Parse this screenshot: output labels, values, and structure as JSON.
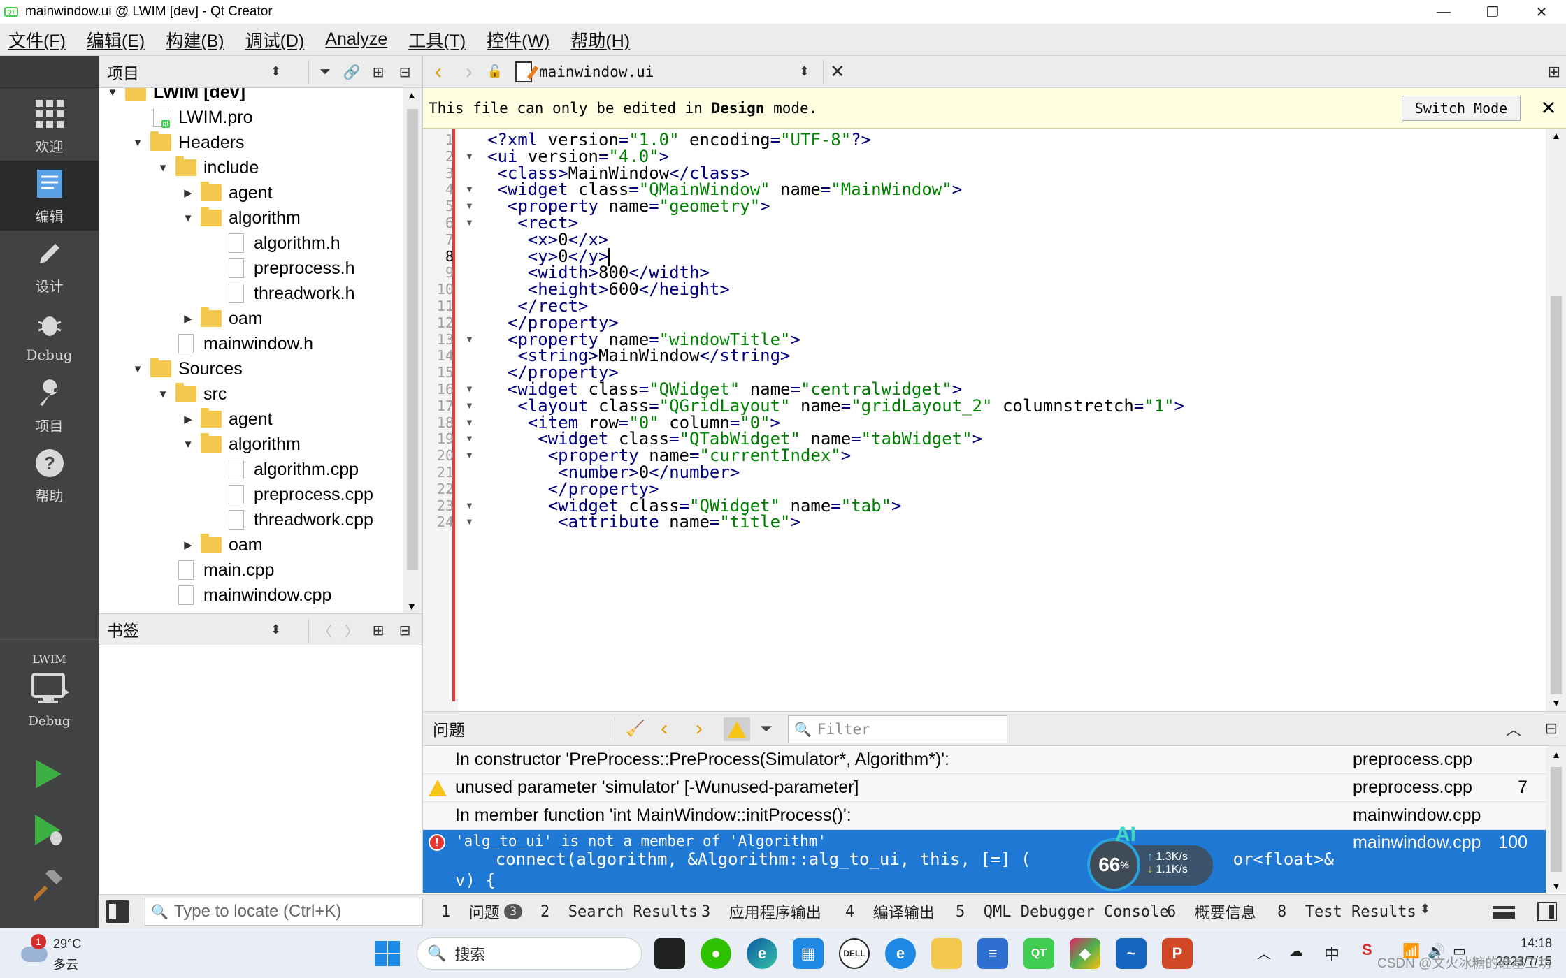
{
  "window": {
    "title": "mainwindow.ui @ LWIM [dev] - Qt Creator",
    "app_icon": "QT"
  },
  "menubar": {
    "items": [
      "文件(F)",
      "编辑(E)",
      "构建(B)",
      "调试(D)",
      "Analyze",
      "工具(T)",
      "控件(W)",
      "帮助(H)"
    ]
  },
  "modes": [
    {
      "label": "欢迎",
      "icon": "welcome-grid-icon"
    },
    {
      "label": "编辑",
      "icon": "edit-document-icon",
      "active": true
    },
    {
      "label": "设计",
      "icon": "design-pencil-icon"
    },
    {
      "label": "Debug",
      "icon": "debug-bug-icon"
    },
    {
      "label": "项目",
      "icon": "project-wrench-icon"
    },
    {
      "label": "帮助",
      "icon": "help-question-icon"
    }
  ],
  "kit": {
    "project": "LWIM",
    "build_mode": "Debug"
  },
  "project_panel": {
    "title": "项目",
    "tree": [
      {
        "label": "LWIM [dev]",
        "type": "project",
        "arrow": "▼",
        "bold": true
      },
      {
        "label": "LWIM.pro",
        "type": "qtfile",
        "arrow": ""
      },
      {
        "label": "Headers",
        "type": "folder-h",
        "arrow": "▼"
      },
      {
        "label": "include",
        "type": "folder",
        "arrow": "▼"
      },
      {
        "label": "agent",
        "type": "folder",
        "arrow": "▶"
      },
      {
        "label": "algorithm",
        "type": "folder",
        "arrow": "▼"
      },
      {
        "label": "algorithm.h",
        "type": "file",
        "arrow": ""
      },
      {
        "label": "preprocess.h",
        "type": "file",
        "arrow": ""
      },
      {
        "label": "threadwork.h",
        "type": "file",
        "arrow": ""
      },
      {
        "label": "oam",
        "type": "folder",
        "arrow": "▶"
      },
      {
        "label": "mainwindow.h",
        "type": "file",
        "arrow": ""
      },
      {
        "label": "Sources",
        "type": "folder-cpp",
        "arrow": "▼"
      },
      {
        "label": "src",
        "type": "folder",
        "arrow": "▼"
      },
      {
        "label": "agent",
        "type": "folder",
        "arrow": "▶"
      },
      {
        "label": "algorithm",
        "type": "folder",
        "arrow": "▼"
      },
      {
        "label": "algorithm.cpp",
        "type": "file",
        "arrow": ""
      },
      {
        "label": "preprocess.cpp",
        "type": "file",
        "arrow": ""
      },
      {
        "label": "threadwork.cpp",
        "type": "file",
        "arrow": ""
      },
      {
        "label": "oam",
        "type": "folder",
        "arrow": "▶"
      },
      {
        "label": "main.cpp",
        "type": "file",
        "arrow": ""
      },
      {
        "label": "mainwindow.cpp",
        "type": "file",
        "arrow": ""
      }
    ]
  },
  "bookmarks_panel": {
    "title": "书签"
  },
  "editor": {
    "document": "mainwindow.ui",
    "info_message_prefix": "This file can only be edited in ",
    "info_message_bold": "Design",
    "info_message_suffix": " mode.",
    "switch_mode_label": "Switch Mode",
    "current_line": 8,
    "lines": [
      {
        "n": "1",
        "fold": "",
        "code": "<?xml version=\"1.0\" encoding=\"UTF-8\"?>"
      },
      {
        "n": "2",
        "fold": "▼",
        "code": "<ui version=\"4.0\">"
      },
      {
        "n": "3",
        "fold": "",
        "code": " <class>MainWindow</class>"
      },
      {
        "n": "4",
        "fold": "▼",
        "code": " <widget class=\"QMainWindow\" name=\"MainWindow\">"
      },
      {
        "n": "5",
        "fold": "▼",
        "code": "  <property name=\"geometry\">"
      },
      {
        "n": "6",
        "fold": "▼",
        "code": "   <rect>"
      },
      {
        "n": "7",
        "fold": "",
        "code": "    <x>0</x>"
      },
      {
        "n": "8",
        "fold": "",
        "code": "    <y>0</y>"
      },
      {
        "n": "9",
        "fold": "",
        "code": "    <width>800</width>"
      },
      {
        "n": "10",
        "fold": "",
        "code": "    <height>600</height>"
      },
      {
        "n": "11",
        "fold": "",
        "code": "   </rect>"
      },
      {
        "n": "12",
        "fold": "",
        "code": "  </property>"
      },
      {
        "n": "13",
        "fold": "▼",
        "code": "  <property name=\"windowTitle\">"
      },
      {
        "n": "14",
        "fold": "",
        "code": "   <string>MainWindow</string>"
      },
      {
        "n": "15",
        "fold": "",
        "code": "  </property>"
      },
      {
        "n": "16",
        "fold": "▼",
        "code": "  <widget class=\"QWidget\" name=\"centralwidget\">"
      },
      {
        "n": "17",
        "fold": "▼",
        "code": "   <layout class=\"QGridLayout\" name=\"gridLayout_2\" columnstretch=\"1\">"
      },
      {
        "n": "18",
        "fold": "▼",
        "code": "    <item row=\"0\" column=\"0\">"
      },
      {
        "n": "19",
        "fold": "▼",
        "code": "     <widget class=\"QTabWidget\" name=\"tabWidget\">"
      },
      {
        "n": "20",
        "fold": "▼",
        "code": "      <property name=\"currentIndex\">"
      },
      {
        "n": "21",
        "fold": "",
        "code": "       <number>0</number>"
      },
      {
        "n": "22",
        "fold": "",
        "code": "      </property>"
      },
      {
        "n": "23",
        "fold": "▼",
        "code": "      <widget class=\"QWidget\" name=\"tab\">"
      },
      {
        "n": "24",
        "fold": "▼",
        "code": "       <attribute name=\"title\">"
      }
    ]
  },
  "issues_panel": {
    "title": "问题",
    "filter_placeholder": "Filter",
    "rows": [
      {
        "icon": "",
        "message": "In constructor 'PreProcess::PreProcess(Simulator*, Algorithm*)':",
        "file": "preprocess.cpp",
        "line": ""
      },
      {
        "icon": "warning",
        "message": "unused parameter 'simulator' [-Wunused-parameter]",
        "file": "preprocess.cpp",
        "line": "7"
      },
      {
        "icon": "",
        "message": "In member function 'int MainWindow::initProcess()':",
        "file": "mainwindow.cpp",
        "line": ""
      }
    ],
    "selected": {
      "icon": "error",
      "message_line1": "'alg_to_ui' is not a member of 'Algorithm'",
      "message_line2": "    connect(algorithm, &Algorithm::alg_to_ui, this, [=] (                    or<float>&",
      "message_line3": "v) {",
      "file": "mainwindow.cpp",
      "line": "100"
    }
  },
  "net_widget": {
    "percent": "66",
    "percent_unit": "%",
    "up": "1.3K/s",
    "down": "1.1K/s",
    "ai_label": "AI"
  },
  "statusbar": {
    "locator_placeholder": "Type to locate (Ctrl+K)",
    "tabs": [
      {
        "num": "1",
        "label": "问题",
        "badge": "3"
      },
      {
        "num": "2",
        "label": "Search Results"
      },
      {
        "num": "3",
        "label": "应用程序输出"
      },
      {
        "num": "4",
        "label": "编译输出"
      },
      {
        "num": "5",
        "label": "QML Debugger Console"
      },
      {
        "num": "6",
        "label": "概要信息"
      },
      {
        "num": "8",
        "label": "Test Results"
      }
    ]
  },
  "taskbar": {
    "weather_temp": "29°C",
    "weather_cond": "多云",
    "weather_badge": "1",
    "search_placeholder": "搜索",
    "tray_ime": "中",
    "clock_time": "14:18",
    "clock_date": "2023/7/15",
    "watermark": "CSDN @文火冰糖的硅基工坊",
    "colors": {
      "windows_blue": "#1e88e5",
      "qt_green": "#41cd52",
      "powerpoint": "#d24726"
    }
  }
}
